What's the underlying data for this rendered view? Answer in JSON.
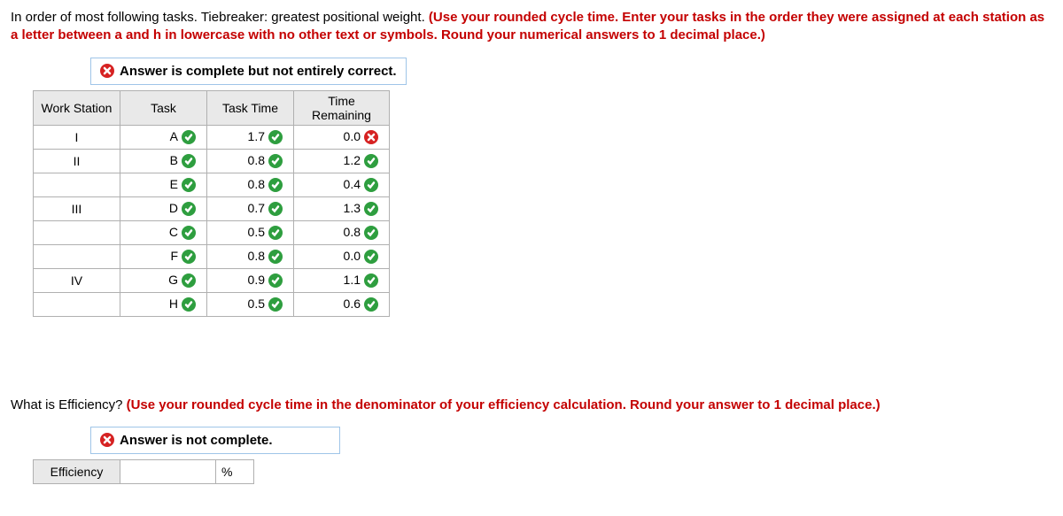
{
  "intro": {
    "black": "In order of most following tasks. Tiebreaker: greatest positional weight. ",
    "red": "(Use your rounded cycle time. Enter your tasks in the order they were assigned at each station as a letter between a and h in lowercase with no other text or symbols. Round your numerical answers to 1 decimal place.)"
  },
  "banner1": "Answer is complete but not entirely correct.",
  "table": {
    "headers": {
      "ws": "Work Station",
      "task": "Task",
      "tt": "Task Time",
      "tr": "Time Remaining"
    },
    "rows": [
      {
        "ws": "I",
        "task": "A",
        "task_ok": true,
        "tt": "1.7",
        "tt_ok": true,
        "tr": "0.0",
        "tr_ok": false
      },
      {
        "ws": "II",
        "task": "B",
        "task_ok": true,
        "tt": "0.8",
        "tt_ok": true,
        "tr": "1.2",
        "tr_ok": true
      },
      {
        "ws": "",
        "task": "E",
        "task_ok": true,
        "tt": "0.8",
        "tt_ok": true,
        "tr": "0.4",
        "tr_ok": true
      },
      {
        "ws": "III",
        "task": "D",
        "task_ok": true,
        "tt": "0.7",
        "tt_ok": true,
        "tr": "1.3",
        "tr_ok": true
      },
      {
        "ws": "",
        "task": "C",
        "task_ok": true,
        "tt": "0.5",
        "tt_ok": true,
        "tr": "0.8",
        "tr_ok": true
      },
      {
        "ws": "",
        "task": "F",
        "task_ok": true,
        "tt": "0.8",
        "tt_ok": true,
        "tr": "0.0",
        "tr_ok": true
      },
      {
        "ws": "IV",
        "task": "G",
        "task_ok": true,
        "tt": "0.9",
        "tt_ok": true,
        "tr": "1.1",
        "tr_ok": true
      },
      {
        "ws": "",
        "task": "H",
        "task_ok": true,
        "tt": "0.5",
        "tt_ok": true,
        "tr": "0.6",
        "tr_ok": true
      }
    ]
  },
  "q2": {
    "black": "What is Efficiency? ",
    "red": "(Use your rounded cycle time in the denominator of your efficiency calculation. Round your answer to 1 decimal place.)"
  },
  "banner2": "Answer is not complete.",
  "eff": {
    "label": "Efficiency",
    "value": "",
    "unit": "%"
  }
}
